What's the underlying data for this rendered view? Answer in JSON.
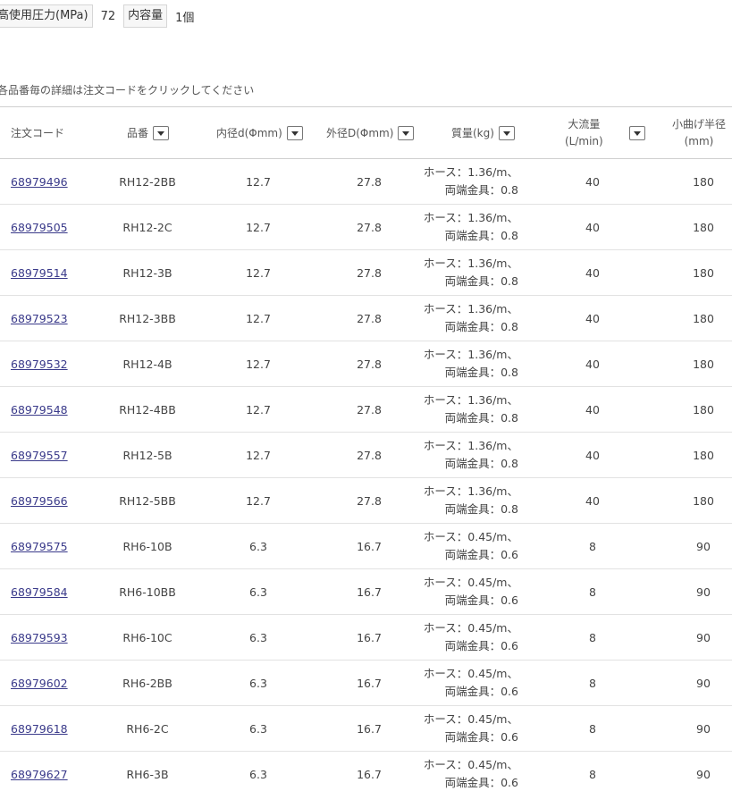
{
  "specs": [
    {
      "label": "高使用圧力(MPa)",
      "value": "72"
    },
    {
      "label": "内容量",
      "value": "1個"
    }
  ],
  "note": "各品番毎の詳細は注文コードをクリックしてください",
  "table": {
    "headers": {
      "code": "注文コード",
      "part": "品番",
      "inner": "内径d(Φmm)",
      "outer": "外径D(Φmm)",
      "mass": "質量(kg)",
      "flow_line1": "大流量",
      "flow_line2": "(L/min)",
      "bend_line1": "小曲げ半径",
      "bend_line2": "(mm)"
    },
    "rows": [
      {
        "code": "68979496",
        "part": "RH12-2BB",
        "inner": "12.7",
        "outer": "27.8",
        "mass1": "ホース：1.36/m、",
        "mass2": "両端金具：0.8",
        "flow": "40",
        "bend": "180"
      },
      {
        "code": "68979505",
        "part": "RH12-2C",
        "inner": "12.7",
        "outer": "27.8",
        "mass1": "ホース：1.36/m、",
        "mass2": "両端金具：0.8",
        "flow": "40",
        "bend": "180"
      },
      {
        "code": "68979514",
        "part": "RH12-3B",
        "inner": "12.7",
        "outer": "27.8",
        "mass1": "ホース：1.36/m、",
        "mass2": "両端金具：0.8",
        "flow": "40",
        "bend": "180"
      },
      {
        "code": "68979523",
        "part": "RH12-3BB",
        "inner": "12.7",
        "outer": "27.8",
        "mass1": "ホース：1.36/m、",
        "mass2": "両端金具：0.8",
        "flow": "40",
        "bend": "180"
      },
      {
        "code": "68979532",
        "part": "RH12-4B",
        "inner": "12.7",
        "outer": "27.8",
        "mass1": "ホース：1.36/m、",
        "mass2": "両端金具：0.8",
        "flow": "40",
        "bend": "180"
      },
      {
        "code": "68979548",
        "part": "RH12-4BB",
        "inner": "12.7",
        "outer": "27.8",
        "mass1": "ホース：1.36/m、",
        "mass2": "両端金具：0.8",
        "flow": "40",
        "bend": "180"
      },
      {
        "code": "68979557",
        "part": "RH12-5B",
        "inner": "12.7",
        "outer": "27.8",
        "mass1": "ホース：1.36/m、",
        "mass2": "両端金具：0.8",
        "flow": "40",
        "bend": "180"
      },
      {
        "code": "68979566",
        "part": "RH12-5BB",
        "inner": "12.7",
        "outer": "27.8",
        "mass1": "ホース：1.36/m、",
        "mass2": "両端金具：0.8",
        "flow": "40",
        "bend": "180"
      },
      {
        "code": "68979575",
        "part": "RH6-10B",
        "inner": "6.3",
        "outer": "16.7",
        "mass1": "ホース：0.45/m、",
        "mass2": "両端金具：0.6",
        "flow": "8",
        "bend": "90"
      },
      {
        "code": "68979584",
        "part": "RH6-10BB",
        "inner": "6.3",
        "outer": "16.7",
        "mass1": "ホース：0.45/m、",
        "mass2": "両端金具：0.6",
        "flow": "8",
        "bend": "90"
      },
      {
        "code": "68979593",
        "part": "RH6-10C",
        "inner": "6.3",
        "outer": "16.7",
        "mass1": "ホース：0.45/m、",
        "mass2": "両端金具：0.6",
        "flow": "8",
        "bend": "90"
      },
      {
        "code": "68979602",
        "part": "RH6-2BB",
        "inner": "6.3",
        "outer": "16.7",
        "mass1": "ホース：0.45/m、",
        "mass2": "両端金具：0.6",
        "flow": "8",
        "bend": "90"
      },
      {
        "code": "68979618",
        "part": "RH6-2C",
        "inner": "6.3",
        "outer": "16.7",
        "mass1": "ホース：0.45/m、",
        "mass2": "両端金具：0.6",
        "flow": "8",
        "bend": "90"
      },
      {
        "code": "68979627",
        "part": "RH6-3B",
        "inner": "6.3",
        "outer": "16.7",
        "mass1": "ホース：0.45/m、",
        "mass2": "両端金具：0.6",
        "flow": "8",
        "bend": "90"
      }
    ]
  }
}
